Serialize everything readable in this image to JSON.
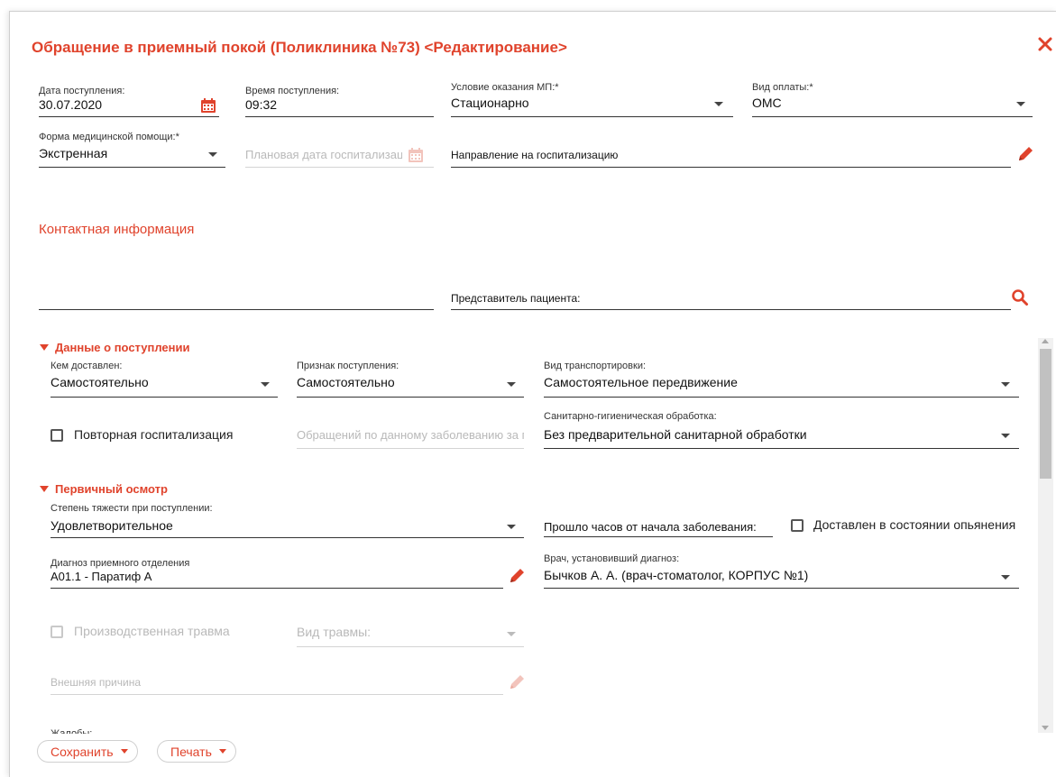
{
  "window": {
    "title": "Обращение в приемный покой (Поликлиника №73) <Редактирование>"
  },
  "fields": {
    "date_in": {
      "label": "Дата поступления:",
      "value": "30.07.2020"
    },
    "time_in": {
      "label": "Время поступления:",
      "value": "09:32"
    },
    "condition": {
      "label": "Условие оказания МП:*",
      "value": "Стационарно"
    },
    "payment": {
      "label": "Вид оплаты:*",
      "value": "ОМС"
    },
    "care_form": {
      "label": "Форма медицинской помощи:*",
      "value": "Экстренная"
    },
    "planned_date": {
      "placeholder": "Плановая дата госпитализации"
    },
    "referral": {
      "text": "Направление на госпитализацию"
    },
    "contact_input": {
      "value": ""
    },
    "representative": {
      "text": "Представитель пациента:"
    }
  },
  "contact_section": "Контактная информация",
  "admission": {
    "title": "Данные о поступлении",
    "delivered_by": {
      "label": "Кем доставлен:",
      "value": "Самостоятельно"
    },
    "admission_sign": {
      "label": "Признак поступления:",
      "value": "Самостоятельно"
    },
    "transport": {
      "label": "Вид транспортировки:",
      "value": "Самостоятельное передвижение"
    },
    "repeat_hosp": {
      "label": "Повторная госпитализация",
      "checked": false
    },
    "visits_count": {
      "placeholder": "Обращений по данному заболеванию за год"
    },
    "sanitary": {
      "label": "Санитарно-гигиеническая обработка:",
      "value": "Без предварительной санитарной обработки"
    }
  },
  "exam": {
    "title": "Первичный осмотр",
    "severity": {
      "label": "Степень тяжести при поступлении:",
      "value": "Удовлетворительное"
    },
    "hours_since": {
      "label": "Прошло часов от начала заболевания:",
      "value": ""
    },
    "intoxicated": {
      "label": "Доставлен в состоянии опьянения",
      "checked": false
    },
    "diagnosis": {
      "label": "Диагноз приемного отделения",
      "value": "А01.1 - Паратиф А"
    },
    "doctor": {
      "label": "Врач, установивший диагноз:",
      "value": "Бычков А. А. (врач-стоматолог, КОРПУС №1)"
    },
    "work_injury": {
      "label": "Производственная травма",
      "checked": false
    },
    "injury_type": {
      "placeholder": "Вид травмы:"
    },
    "external_cause": {
      "placeholder": "Внешняя причина"
    },
    "complaints": {
      "label": "Жалобы:"
    }
  },
  "footer": {
    "save_label": "Сохранить",
    "print_label": "Печать"
  },
  "colors": {
    "accent": "#e0432c",
    "text": "#222222",
    "disabled": "#b9b9b9"
  }
}
